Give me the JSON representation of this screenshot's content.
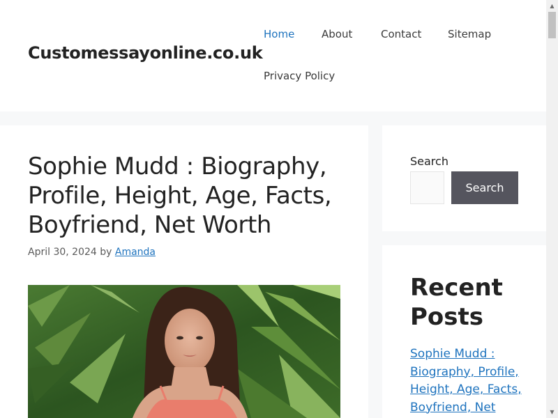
{
  "site": {
    "title": "Customessayonline.co.uk"
  },
  "nav": {
    "items": [
      {
        "label": "Home",
        "active": true
      },
      {
        "label": "About"
      },
      {
        "label": "Contact"
      },
      {
        "label": "Sitemap"
      },
      {
        "label": "Privacy Policy"
      }
    ]
  },
  "article": {
    "title": "Sophie Mudd : Biography, Profile, Height, Age, Facts, Boyfriend, Net Worth",
    "date": "April 30, 2024",
    "by_text": "by",
    "author": "Amanda"
  },
  "sidebar": {
    "search": {
      "label": "Search",
      "button_label": "Search"
    },
    "recent": {
      "heading": "Recent Posts",
      "posts": [
        "Sophie Mudd : Biography, Profile, Height, Age, Facts, Boyfriend, Net Worth"
      ]
    }
  },
  "colors": {
    "link": "#1e73be",
    "search_button": "#55555e",
    "page_background": "#f7f8f9"
  }
}
